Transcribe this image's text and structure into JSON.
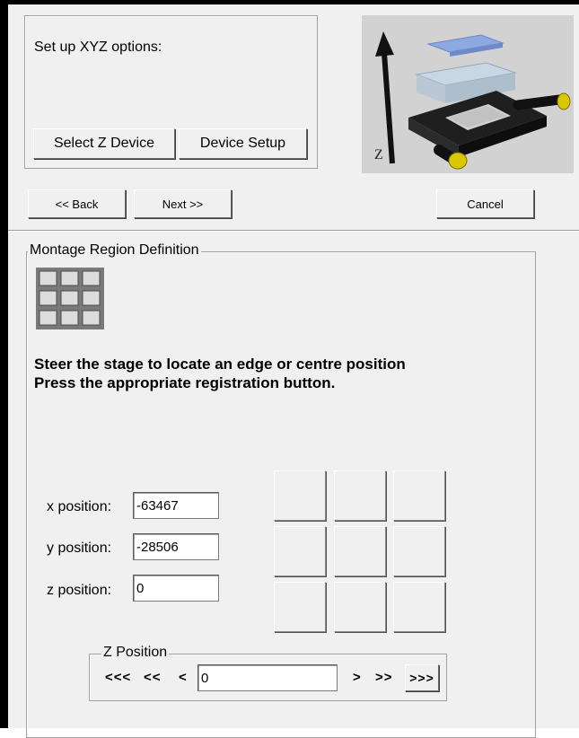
{
  "setup": {
    "prompt": "Set up XYZ options:",
    "select_z_label": "Select Z Device",
    "device_setup_label": "Device Setup",
    "image_axis_label": "Z"
  },
  "nav": {
    "back_label": "<< Back",
    "next_label": "Next >>",
    "cancel_label": "Cancel"
  },
  "montage": {
    "legend": "Montage Region Definition",
    "instruction_line1": "Steer the stage to locate an edge or centre position",
    "instruction_line2": "Press the appropriate registration button."
  },
  "positions": {
    "x_label": "x position:",
    "x_value": "-63467",
    "y_label": "y position:",
    "y_value": "-28506",
    "z_label": "z position:",
    "z_value": "0"
  },
  "z_position": {
    "legend": "Z Position",
    "btn_down3": "<<<",
    "btn_down2": "<<",
    "btn_down1": "<",
    "value": "0",
    "btn_up1": ">",
    "btn_up2": ">>",
    "btn_up3": ">>>"
  },
  "colors": {
    "panel": "#f0f0f0",
    "stage_black": "#1a1a1a",
    "stage_yellow": "#d8c800",
    "slide_blue": "#8ea8e0"
  },
  "icons": [
    "montage-grid-icon",
    "xyz-stage-illustration"
  ]
}
